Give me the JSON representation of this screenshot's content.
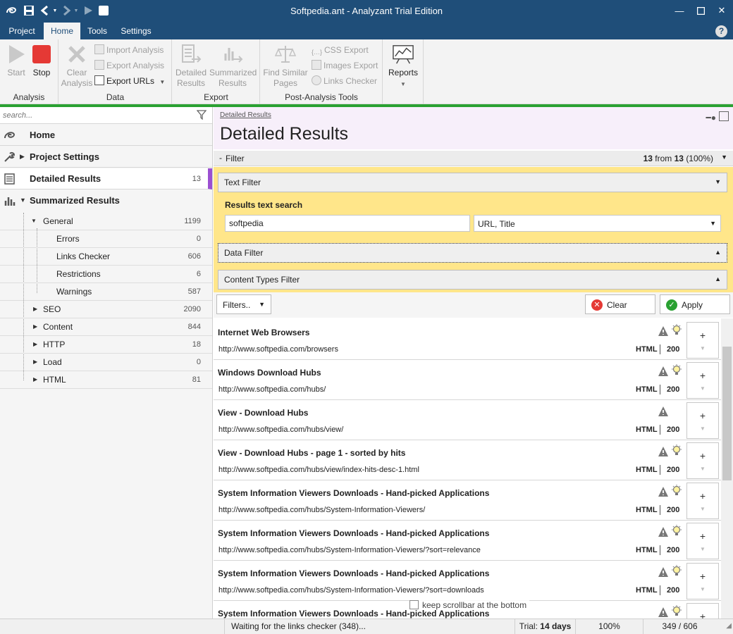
{
  "window": {
    "title": "Softpedia.ant - Analyzant Trial Edition"
  },
  "menu": {
    "tabs": [
      "Project",
      "Home",
      "Tools",
      "Settings"
    ],
    "active": "Home",
    "help": "?"
  },
  "ribbon": {
    "groups": {
      "analysis": "Analysis",
      "data": "Data",
      "export": "Export",
      "post": "Post-Analysis Tools",
      "reports": ""
    },
    "start": "Start",
    "stop": "Stop",
    "clear_line1": "Clear",
    "clear_line2": "Analysis",
    "import_analysis": "Import Analysis",
    "export_analysis": "Export Analysis",
    "export_urls": "Export URLs",
    "detailed_line1": "Detailed",
    "detailed_line2": "Results",
    "summarized_line1": "Summarized",
    "summarized_line2": "Results",
    "find_line1": "Find Similar",
    "find_line2": "Pages",
    "css_export": "CSS Export",
    "images_export": "Images Export",
    "links_checker": "Links Checker",
    "reports": "Reports"
  },
  "sidebar": {
    "search_placeholder": "search...",
    "items": [
      {
        "label": "Home",
        "count": ""
      },
      {
        "label": "Project Settings",
        "count": ""
      },
      {
        "label": "Detailed Results",
        "count": "13"
      },
      {
        "label": "Summarized Results",
        "count": ""
      }
    ],
    "general": {
      "label": "General",
      "count": "1199"
    },
    "general_children": [
      {
        "label": "Errors",
        "count": "0"
      },
      {
        "label": "Links Checker",
        "count": "606"
      },
      {
        "label": "Restrictions",
        "count": "6"
      },
      {
        "label": "Warnings",
        "count": "587"
      }
    ],
    "groups": [
      {
        "label": "SEO",
        "count": "2090"
      },
      {
        "label": "Content",
        "count": "844"
      },
      {
        "label": "HTTP",
        "count": "18"
      },
      {
        "label": "Load",
        "count": "0"
      },
      {
        "label": "HTML",
        "count": "81"
      }
    ]
  },
  "main": {
    "breadcrumb": "Detailed Results",
    "title": "Detailed Results",
    "filter": {
      "toggle": "-",
      "label": "Filter",
      "shown": "13",
      "from_word": "from",
      "total": "13",
      "percent": "(100%)"
    },
    "text_filter": "Text Filter",
    "results_text_search": "Results text search",
    "search_value": "softpedia",
    "search_scope": "URL, Title",
    "data_filter": "Data Filter",
    "content_types_filter": "Content Types Filter",
    "filters_dropdown": "Filters..",
    "clear": "Clear",
    "apply": "Apply",
    "keep_scrollbar": "keep scrollbar at the bottom"
  },
  "results": [
    {
      "title": "Internet Web Browsers",
      "url": "http://www.softpedia.com/browsers",
      "type": "HTML",
      "code": "200",
      "bulb": true
    },
    {
      "title": "Windows Download Hubs",
      "url": "http://www.softpedia.com/hubs/",
      "type": "HTML",
      "code": "200",
      "bulb": true
    },
    {
      "title": "View - Download Hubs",
      "url": "http://www.softpedia.com/hubs/view/",
      "type": "HTML",
      "code": "200",
      "bulb": false
    },
    {
      "title": "View - Download Hubs - page 1 - sorted by hits",
      "url": "http://www.softpedia.com/hubs/view/index-hits-desc-1.html",
      "type": "HTML",
      "code": "200",
      "bulb": true
    },
    {
      "title": "System Information Viewers Downloads - Hand-picked Applications",
      "url": "http://www.softpedia.com/hubs/System-Information-Viewers/",
      "type": "HTML",
      "code": "200",
      "bulb": true
    },
    {
      "title": "System Information Viewers Downloads - Hand-picked Applications",
      "url": "http://www.softpedia.com/hubs/System-Information-Viewers/?sort=relevance",
      "type": "HTML",
      "code": "200",
      "bulb": true
    },
    {
      "title": "System Information Viewers Downloads - Hand-picked Applications",
      "url": "http://www.softpedia.com/hubs/System-Information-Viewers/?sort=downloads",
      "type": "HTML",
      "code": "200",
      "bulb": true
    },
    {
      "title": "System Information Viewers Downloads - Hand-picked Applications",
      "url": "",
      "type": "",
      "code": "",
      "bulb": true
    }
  ],
  "status": {
    "message": "Waiting for the links checker (348)...",
    "trial_label": "Trial:",
    "trial_days": "14 days",
    "zoom": "100%",
    "progress": "349 / 606"
  },
  "colors": {
    "titlebar": "#1f4e79",
    "accent_green": "#2aa132",
    "filter_yellow": "#ffe68a",
    "selected_marker": "#9b4fd1",
    "stop_red": "#e53935"
  },
  "icons": [
    "app-logo-icon",
    "save-icon",
    "back-icon",
    "forward-icon",
    "play-icon",
    "stop-icon",
    "close-icon",
    "funnel-icon",
    "home-icon",
    "wrench-icon",
    "list-icon",
    "bar-chart-icon",
    "warning-icon",
    "bulb-icon",
    "scales-icon",
    "chart-line-icon",
    "pin-icon",
    "popout-icon"
  ]
}
